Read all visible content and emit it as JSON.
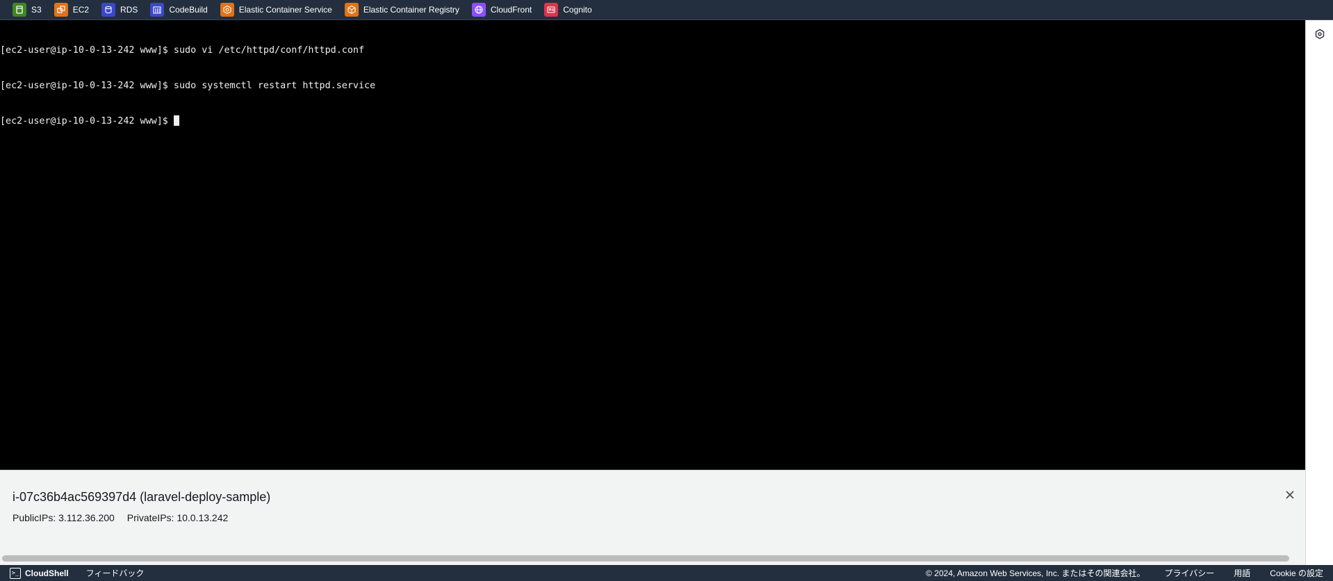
{
  "favorites": [
    {
      "label": "S3",
      "icon": "s3-icon",
      "color": "#3f8624"
    },
    {
      "label": "EC2",
      "icon": "ec2-icon",
      "color": "#e07316"
    },
    {
      "label": "RDS",
      "icon": "rds-icon",
      "color": "#3b48cc"
    },
    {
      "label": "CodeBuild",
      "icon": "codebuild-icon",
      "color": "#3b48cc"
    },
    {
      "label": "Elastic Container Service",
      "icon": "ecs-icon",
      "color": "#e07316"
    },
    {
      "label": "Elastic Container Registry",
      "icon": "ecr-icon",
      "color": "#e07316"
    },
    {
      "label": "CloudFront",
      "icon": "cloudfront-icon",
      "color": "#8c4fff"
    },
    {
      "label": "Cognito",
      "icon": "cognito-icon",
      "color": "#dd344c"
    }
  ],
  "terminal": {
    "lines": [
      "[ec2-user@ip-10-0-13-242 www]$ sudo vi /etc/httpd/conf/httpd.conf",
      "[ec2-user@ip-10-0-13-242 www]$ sudo systemctl restart httpd.service",
      "[ec2-user@ip-10-0-13-242 www]$ "
    ]
  },
  "instance": {
    "title": "i-07c36b4ac569397d4 (laravel-deploy-sample)",
    "public_ips": "PublicIPs: 3.112.36.200",
    "private_ips": "PrivateIPs: 10.0.13.242"
  },
  "footer": {
    "cloudshell": "CloudShell",
    "feedback": "フィードバック",
    "copyright": "© 2024, Amazon Web Services, Inc. またはその関連会社。",
    "privacy": "プライバシー",
    "terms": "用語",
    "cookie": "Cookie の設定"
  }
}
